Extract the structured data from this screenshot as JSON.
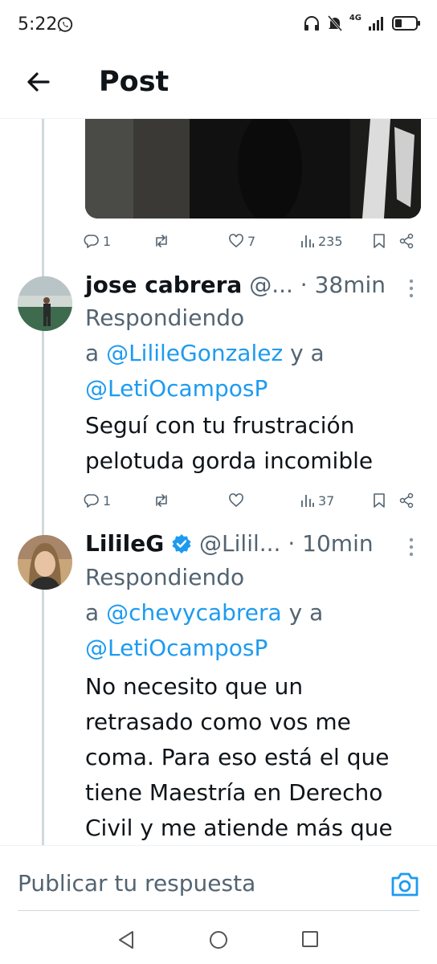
{
  "status": {
    "time": "5:22",
    "network": "4G"
  },
  "header": {
    "title": "Post"
  },
  "tweet0": {
    "replies": "1",
    "retweets": "",
    "likes": "7",
    "views": "235"
  },
  "tweet1": {
    "name": "jose cabrera",
    "handle": "@...",
    "dot": "·",
    "time": "38min",
    "replying_prefix": "Respondiendo",
    "replying_a": "a",
    "mention1": "@LilileGonzalez",
    "replying_and": "y a",
    "mention2": "@LetiOcamposP",
    "body_line1": "Seguí con tu frustración",
    "body_line2": "pelotuda gorda incomible",
    "replies": "1",
    "likes": "",
    "views": "37"
  },
  "tweet2": {
    "name": "LilileG",
    "handle": "@Lilil...",
    "dot": "·",
    "time": "10min",
    "replying_prefix": "Respondiendo",
    "replying_a": "a",
    "mention1": "@chevycabrera",
    "replying_and": "y a",
    "mention2": "@LetiOcamposP",
    "body_line1": "No necesito que un",
    "body_line2": "retrasado como vos me",
    "body_line3": "coma. Para eso está el que",
    "body_line4": "tiene Maestría en Derecho",
    "body_line5": "Civil y me atiende más que"
  },
  "reply": {
    "placeholder": "Publicar tu respuesta"
  },
  "colors": {
    "accent": "#1d9bf0",
    "muted": "#536471",
    "text": "#0f1419"
  },
  "icons": [
    "whatsapp-icon",
    "back-arrow-icon",
    "reply-icon",
    "retweet-icon",
    "like-icon",
    "views-icon",
    "bookmark-icon",
    "share-icon",
    "more-icon",
    "verified-icon",
    "camera-icon"
  ]
}
